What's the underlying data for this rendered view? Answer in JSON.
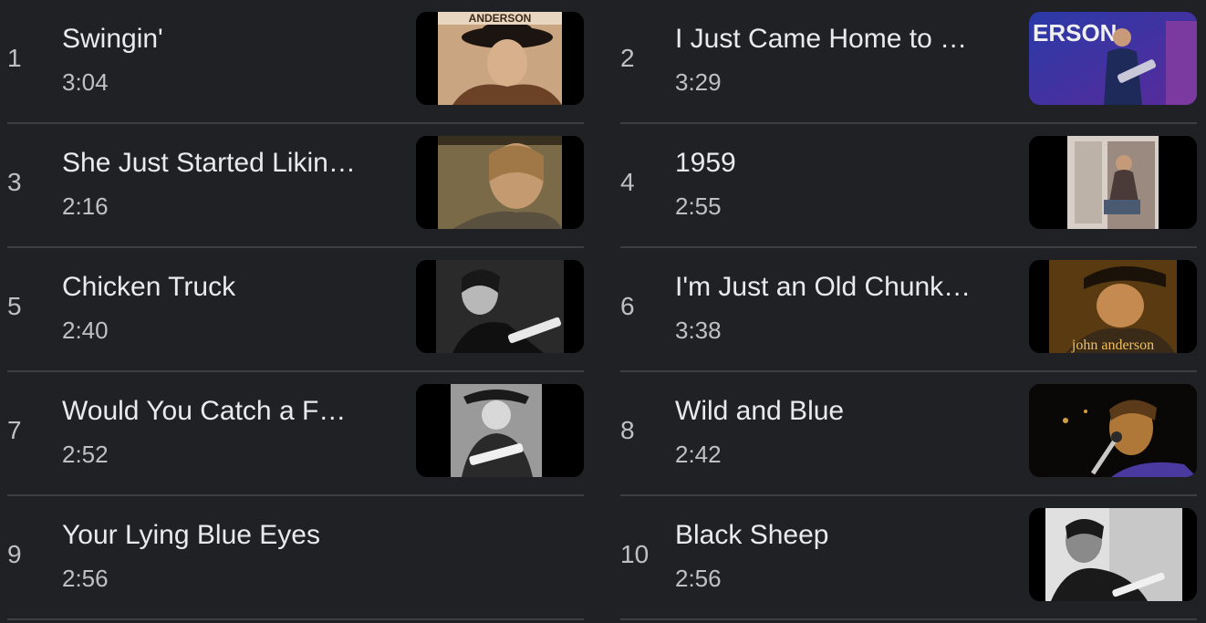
{
  "songs": [
    {
      "rank": "1",
      "title": "Swingin'",
      "duration": "3:04",
      "thumbnail": "album-cover-cowboy-hat"
    },
    {
      "rank": "2",
      "title": "I Just Came Home to …",
      "duration": "3:29",
      "thumbnail": "concert-guitarist-stage"
    },
    {
      "rank": "3",
      "title": "She Just Started Likin…",
      "duration": "2:16",
      "thumbnail": "album-cover-portrait"
    },
    {
      "rank": "4",
      "title": "1959",
      "duration": "2:55",
      "thumbnail": "man-sitting-on-steps"
    },
    {
      "rank": "5",
      "title": "Chicken Truck",
      "duration": "2:40",
      "thumbnail": "bw-guitarist"
    },
    {
      "rank": "6",
      "title": "I'm Just an Old Chunk…",
      "duration": "3:38",
      "thumbnail": "album-cover-john-anderson"
    },
    {
      "rank": "7",
      "title": "Would You Catch a F…",
      "duration": "2:52",
      "thumbnail": "bw-cowboy-guitarist"
    },
    {
      "rank": "8",
      "title": "Wild and Blue",
      "duration": "2:42",
      "thumbnail": "singer-microphone-live"
    },
    {
      "rank": "9",
      "title": "Your Lying Blue Eyes",
      "duration": "2:56",
      "thumbnail": ""
    },
    {
      "rank": "10",
      "title": "Black Sheep",
      "duration": "2:56",
      "thumbnail": "bw-guitarist-closeup"
    }
  ],
  "thumbnail_text": {
    "t1": "ANDERSON",
    "t2": "ERSON",
    "t6": "john anderson"
  }
}
